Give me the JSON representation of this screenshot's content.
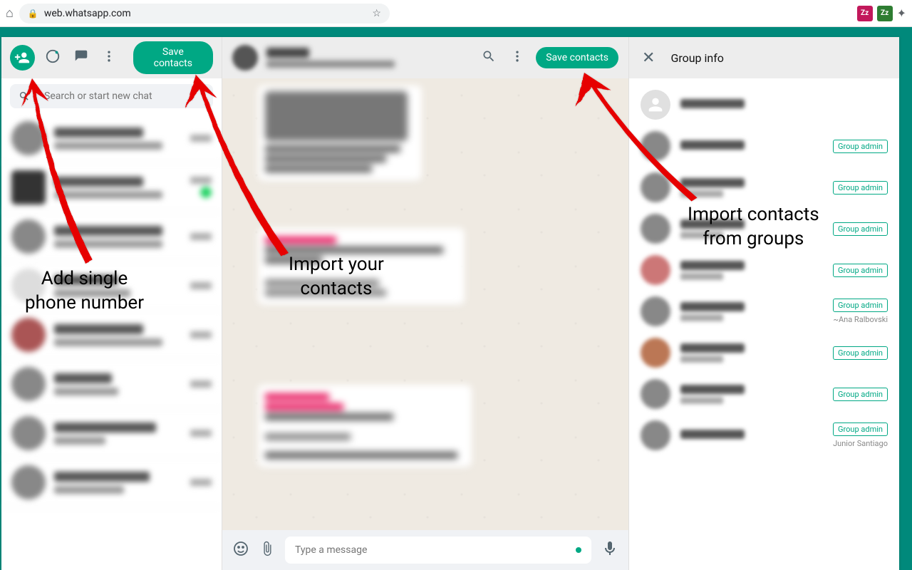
{
  "browser": {
    "url": "web.whatsapp.com"
  },
  "left": {
    "save_label": "Save contacts",
    "search_placeholder": "Search or start new chat"
  },
  "middle": {
    "save_label": "Save contacts",
    "input_placeholder": "Type a message"
  },
  "right": {
    "title": "Group info",
    "admin_label": "Group admin",
    "members": [
      {
        "sub": ""
      },
      {
        "sub": ""
      },
      {
        "sub": ""
      },
      {
        "sub": ""
      },
      {
        "sub": "~Ana Ralbovski"
      },
      {
        "sub": ""
      },
      {
        "sub": ""
      },
      {
        "sub": "Junior Santiago"
      }
    ]
  },
  "annotations": {
    "add_single": "Add single\nphone number",
    "import_contacts": "Import your\ncontacts",
    "import_groups": "Import contacts\nfrom groups"
  }
}
